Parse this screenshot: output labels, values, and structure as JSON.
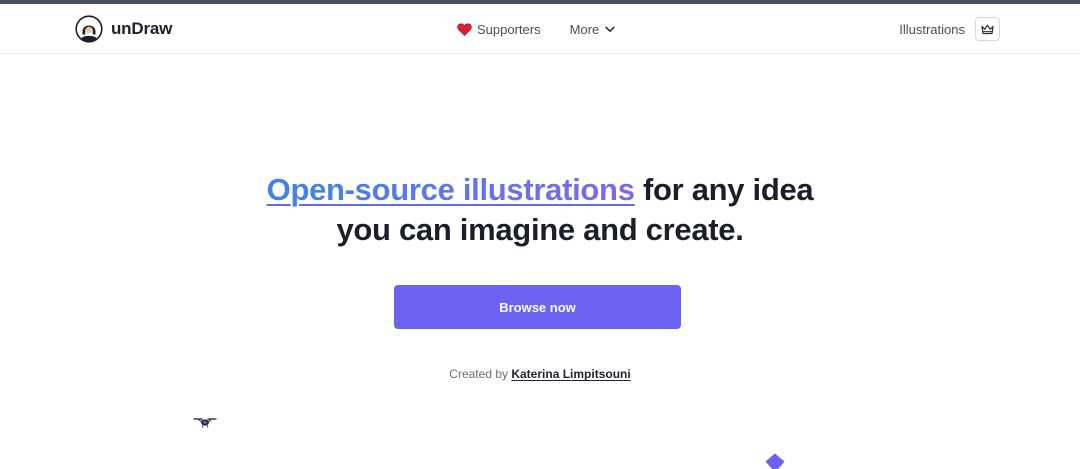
{
  "nav": {
    "brand": "unDraw",
    "supporters_label": "Supporters",
    "more_label": "More",
    "illustrations_label": "Illustrations"
  },
  "hero": {
    "title_highlight": "Open-source illustrations",
    "title_rest_line1": " for any idea",
    "title_line2": "you can imagine and create."
  },
  "cta": {
    "label": "Browse now"
  },
  "credit": {
    "prefix": "Created by ",
    "author": "Katerina Limpitsouni"
  },
  "colors": {
    "accent": "#6c63f2",
    "highlight_start": "#3f84ea",
    "highlight_end": "#8067ec",
    "heart": "#e11d33",
    "text_dark": "#1c1f2b"
  },
  "icons": {
    "brand": "undraw-avatar-icon",
    "supporters": "heart-icon",
    "more": "chevron-down-icon",
    "cart": "crown-icon",
    "drone": "drone-icon",
    "diamond": "diamond-icon"
  }
}
